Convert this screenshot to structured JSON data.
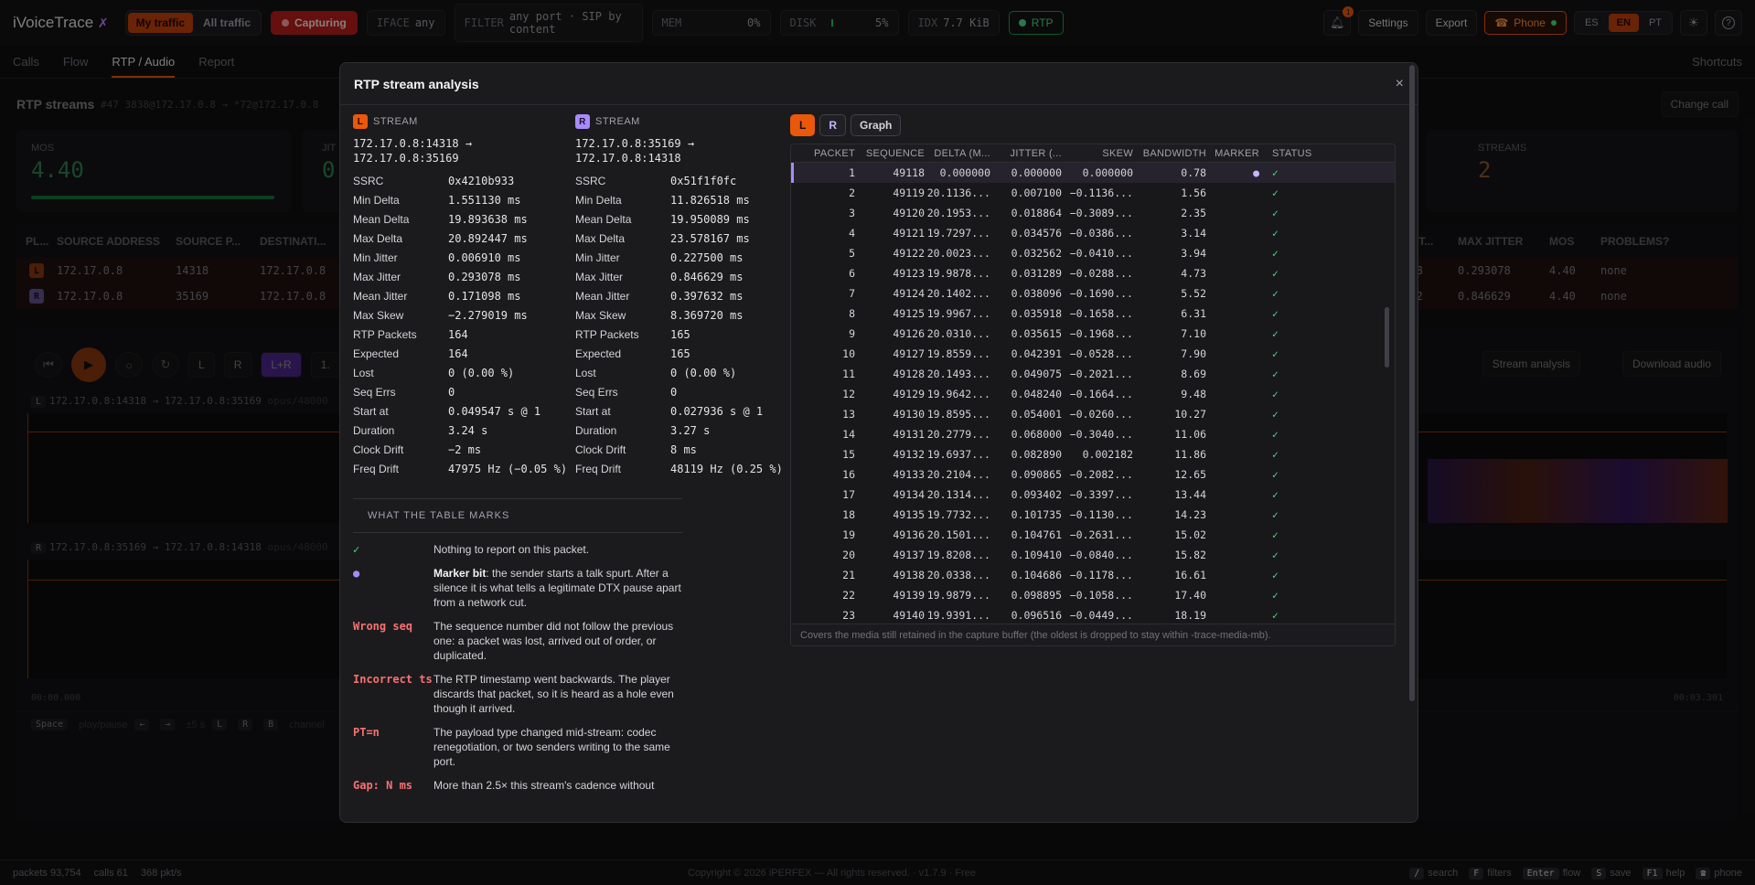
{
  "app": {
    "name": "iVoiceTrace",
    "logo_mark": "✗"
  },
  "topbar": {
    "traffic_tabs": [
      "My traffic",
      "All traffic"
    ],
    "capture_label": "Capturing",
    "iface": {
      "label": "IFACE",
      "value": "any"
    },
    "filter": {
      "label": "FILTER",
      "value": "any port · SIP by content"
    },
    "mem": {
      "label": "MEM",
      "value": "0%"
    },
    "disk": {
      "label": "DISK",
      "value": "5%"
    },
    "idx": {
      "label": "IDX",
      "value": "7.7 KiB"
    },
    "rtp_label": "RTP",
    "notif_count": "1",
    "settings": "Settings",
    "export": "Export",
    "phone": "Phone",
    "langs": [
      "ES",
      "EN",
      "PT"
    ],
    "active_lang": "EN",
    "theme_icon": "☀",
    "help_icon": "?"
  },
  "tabs": {
    "items": [
      "Calls",
      "Flow",
      "RTP / Audio",
      "Report"
    ],
    "active": "RTP / Audio",
    "shortcuts": "Shortcuts"
  },
  "background": {
    "section_title": "RTP streams",
    "call_ref": "#47 3838@172.17.0.8 → *72@172.17.0.8",
    "change_call": "Change call",
    "mos_label": "MOS",
    "mos_value": "4.40",
    "jitter_abbr": "JIT",
    "jitter_value": "0",
    "streams_label": "STREAMS",
    "streams_value": "2",
    "cols": [
      "PL...",
      "SOURCE ADDRESS",
      "SOURCE P...",
      "DESTINATI...",
      "JITT...",
      "MAX JITTER",
      "MOS",
      "PROBLEMS?"
    ],
    "rows": [
      {
        "ch": "L",
        "src": "172.17.0.8",
        "port": "14318",
        "dst": "172.17.0.8",
        "jitt": "098",
        "max": "0.293078",
        "mos": "4.40",
        "prob": "none"
      },
      {
        "ch": "R",
        "src": "172.17.0.8",
        "port": "35169",
        "dst": "172.17.0.8",
        "jitt": "632",
        "max": "0.846629",
        "mos": "4.40",
        "prob": "none"
      }
    ],
    "player_buttons": [
      "L",
      "R",
      "L+R",
      "1."
    ],
    "stream_analysis": "Stream analysis",
    "download_audio": "Download audio",
    "wave_l": "172.17.0.8:14318 → 172.17.0.8:35169",
    "wave_r": "172.17.0.8:35169 → 172.17.0.8:14318",
    "codec": "opus/48000",
    "t_start": "00:00.000",
    "t_end": "00:03.301",
    "hint_space": "Space",
    "hint_play": "play/pause",
    "hint_seek": "±5 s",
    "hint_channel": "channel"
  },
  "modal": {
    "title": "RTP stream analysis",
    "close_icon": "×",
    "stream_word": "STREAM",
    "left": {
      "ch": "L",
      "addr1": "172.17.0.8:14318 →",
      "addr2": "172.17.0.8:35169",
      "stats": [
        [
          "SSRC",
          "0x4210b933"
        ],
        [
          "Min Delta",
          "1.551130 ms"
        ],
        [
          "Mean Delta",
          "19.893638 ms"
        ],
        [
          "Max Delta",
          "20.892447 ms"
        ],
        [
          "Min Jitter",
          "0.006910 ms"
        ],
        [
          "Max Jitter",
          "0.293078 ms"
        ],
        [
          "Mean Jitter",
          "0.171098 ms"
        ],
        [
          "Max Skew",
          "−2.279019 ms"
        ],
        [
          "RTP Packets",
          "164"
        ],
        [
          "Expected",
          "164"
        ],
        [
          "Lost",
          "0 (0.00 %)"
        ],
        [
          "Seq Errs",
          "0"
        ],
        [
          "Start at",
          "0.049547 s @ 1"
        ],
        [
          "Duration",
          "3.24 s"
        ],
        [
          "Clock Drift",
          "−2 ms"
        ],
        [
          "Freq Drift",
          "47975 Hz (−0.05 %)"
        ]
      ]
    },
    "right": {
      "ch": "R",
      "addr1": "172.17.0.8:35169 →",
      "addr2": "172.17.0.8:14318",
      "stats": [
        [
          "SSRC",
          "0x51f1f0fc"
        ],
        [
          "Min Delta",
          "11.826518 ms"
        ],
        [
          "Mean Delta",
          "19.950089 ms"
        ],
        [
          "Max Delta",
          "23.578167 ms"
        ],
        [
          "Min Jitter",
          "0.227500 ms"
        ],
        [
          "Max Jitter",
          "0.846629 ms"
        ],
        [
          "Mean Jitter",
          "0.397632 ms"
        ],
        [
          "Max Skew",
          "8.369720 ms"
        ],
        [
          "RTP Packets",
          "165"
        ],
        [
          "Expected",
          "165"
        ],
        [
          "Lost",
          "0 (0.00 %)"
        ],
        [
          "Seq Errs",
          "0"
        ],
        [
          "Start at",
          "0.027936 s @ 1"
        ],
        [
          "Duration",
          "3.27 s"
        ],
        [
          "Clock Drift",
          "8 ms"
        ],
        [
          "Freq Drift",
          "48119 Hz (0.25 %)"
        ]
      ]
    },
    "legend": {
      "title": "WHAT THE TABLE MARKS",
      "items": [
        {
          "sym": "✓",
          "desc": "Nothing to report on this packet.",
          "bold": ""
        },
        {
          "sym": "●",
          "bold": "Marker bit",
          "desc": ": the sender starts a talk spurt. After a silence it is what tells a legitimate DTX pause apart from a network cut."
        },
        {
          "sym": "Wrong seq",
          "bold": "",
          "desc": "The sequence number did not follow the previous one: a packet was lost, arrived out of order, or duplicated."
        },
        {
          "sym": "Incorrect ts",
          "bold": "",
          "desc": "The RTP timestamp went backwards. The player discards that packet, so it is heard as a hole even though it arrived."
        },
        {
          "sym": "PT=n",
          "bold": "",
          "desc": "The payload type changed mid-stream: codec renegotiation, or two senders writing to the same port."
        },
        {
          "sym": "Gap: N ms",
          "bold": "",
          "desc": "More than 2.5× this stream's cadence without"
        }
      ]
    },
    "view_buttons": [
      "L",
      "R",
      "Graph"
    ],
    "table": {
      "headers": [
        "PACKET",
        "SEQUENCE",
        "DELTA (M...",
        "JITTER (...",
        "SKEW",
        "BANDWIDTH",
        "MARKER",
        "STATUS"
      ],
      "rows": [
        [
          "1",
          "49118",
          "0.000000",
          "0.000000",
          "0.000000",
          "0.78",
          "●",
          "✓"
        ],
        [
          "2",
          "49119",
          "20.1136...",
          "0.007100",
          "−0.1136...",
          "1.56",
          "",
          "✓"
        ],
        [
          "3",
          "49120",
          "20.1953...",
          "0.018864",
          "−0.3089...",
          "2.35",
          "",
          "✓"
        ],
        [
          "4",
          "49121",
          "19.7297...",
          "0.034576",
          "−0.0386...",
          "3.14",
          "",
          "✓"
        ],
        [
          "5",
          "49122",
          "20.0023...",
          "0.032562",
          "−0.0410...",
          "3.94",
          "",
          "✓"
        ],
        [
          "6",
          "49123",
          "19.9878...",
          "0.031289",
          "−0.0288...",
          "4.73",
          "",
          "✓"
        ],
        [
          "7",
          "49124",
          "20.1402...",
          "0.038096",
          "−0.1690...",
          "5.52",
          "",
          "✓"
        ],
        [
          "8",
          "49125",
          "19.9967...",
          "0.035918",
          "−0.1658...",
          "6.31",
          "",
          "✓"
        ],
        [
          "9",
          "49126",
          "20.0310...",
          "0.035615",
          "−0.1968...",
          "7.10",
          "",
          "✓"
        ],
        [
          "10",
          "49127",
          "19.8559...",
          "0.042391",
          "−0.0528...",
          "7.90",
          "",
          "✓"
        ],
        [
          "11",
          "49128",
          "20.1493...",
          "0.049075",
          "−0.2021...",
          "8.69",
          "",
          "✓"
        ],
        [
          "12",
          "49129",
          "19.9642...",
          "0.048240",
          "−0.1664...",
          "9.48",
          "",
          "✓"
        ],
        [
          "13",
          "49130",
          "19.8595...",
          "0.054001",
          "−0.0260...",
          "10.27",
          "",
          "✓"
        ],
        [
          "14",
          "49131",
          "20.2779...",
          "0.068000",
          "−0.3040...",
          "11.06",
          "",
          "✓"
        ],
        [
          "15",
          "49132",
          "19.6937...",
          "0.082890",
          "0.002182",
          "11.86",
          "",
          "✓"
        ],
        [
          "16",
          "49133",
          "20.2104...",
          "0.090865",
          "−0.2082...",
          "12.65",
          "",
          "✓"
        ],
        [
          "17",
          "49134",
          "20.1314...",
          "0.093402",
          "−0.3397...",
          "13.44",
          "",
          "✓"
        ],
        [
          "18",
          "49135",
          "19.7732...",
          "0.101735",
          "−0.1130...",
          "14.23",
          "",
          "✓"
        ],
        [
          "19",
          "49136",
          "20.1501...",
          "0.104761",
          "−0.2631...",
          "15.02",
          "",
          "✓"
        ],
        [
          "20",
          "49137",
          "19.8208...",
          "0.109410",
          "−0.0840...",
          "15.82",
          "",
          "✓"
        ],
        [
          "21",
          "49138",
          "20.0338...",
          "0.104686",
          "−0.1178...",
          "16.61",
          "",
          "✓"
        ],
        [
          "22",
          "49139",
          "19.9879...",
          "0.098895",
          "−0.1058...",
          "17.40",
          "",
          "✓"
        ],
        [
          "23",
          "49140",
          "19.9391...",
          "0.096516",
          "−0.0449...",
          "18.19",
          "",
          "✓"
        ]
      ],
      "footer": "Covers the media still retained in the capture buffer (the oldest is dropped to stay within -trace-media-mb)."
    }
  },
  "statusbar": {
    "packets": "packets 93,754",
    "calls": "calls 61",
    "rate": "368 pkt/s",
    "copyright": "Copyright © 2026 iPERFEX — All rights reserved. · v1.7.9 · Free",
    "shortcuts": [
      [
        "/",
        "search"
      ],
      [
        "F",
        "filters"
      ],
      [
        "Enter",
        "flow"
      ],
      [
        "S",
        "save"
      ],
      [
        "F1",
        "help"
      ],
      [
        "☎",
        "phone"
      ]
    ]
  },
  "colors": {
    "accent": "#ea580c",
    "right_channel": "#a78bfa",
    "ok": "#4ade80",
    "danger": "#f87171"
  }
}
